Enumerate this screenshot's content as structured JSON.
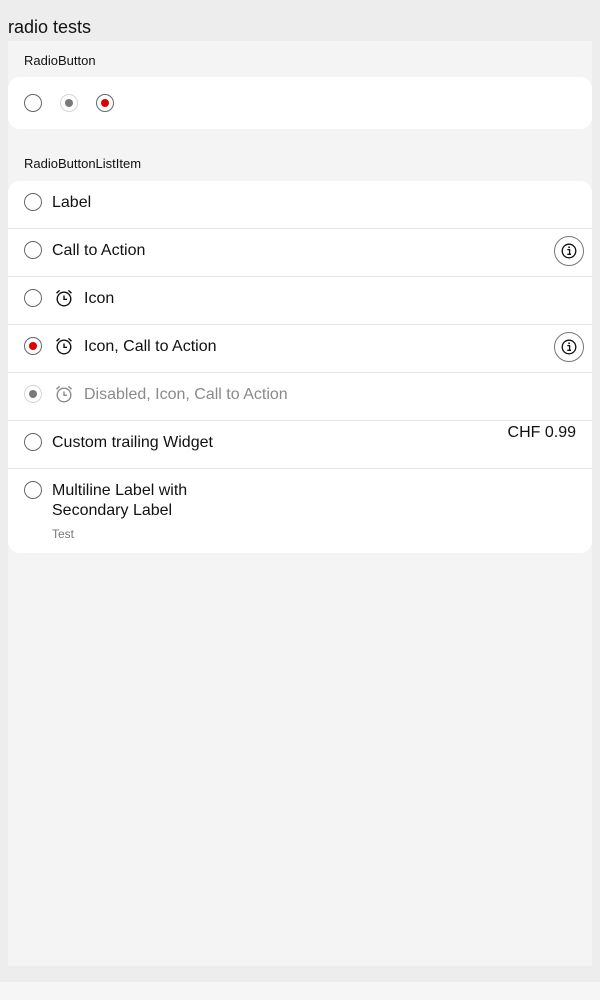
{
  "page": {
    "title": "radio tests"
  },
  "radio_button_section": {
    "label": "RadioButton",
    "radios": [
      {
        "state": "unchecked"
      },
      {
        "state": "checked-disabled"
      },
      {
        "state": "checked"
      }
    ]
  },
  "radio_list_section": {
    "label": "RadioButtonListItem",
    "items": [
      {
        "label": "Label",
        "checked": false
      },
      {
        "label": "Call to Action",
        "checked": false,
        "trailing_icon": "info-icon"
      },
      {
        "label": "Icon",
        "checked": false,
        "leading_icon": "alarm-icon"
      },
      {
        "label": "Icon, Call to Action",
        "checked": true,
        "leading_icon": "alarm-icon",
        "trailing_icon": "info-icon"
      },
      {
        "label": "Disabled, Icon, Call to Action",
        "checked": true,
        "disabled": true,
        "leading_icon": "alarm-icon"
      },
      {
        "label": "Custom trailing Widget",
        "checked": false,
        "trailing_text": "CHF 0.99"
      },
      {
        "label_line1": "Multiline Label with",
        "label_line2": "Secondary Label",
        "secondary": "Test",
        "checked": false
      }
    ]
  },
  "colors": {
    "accent": "#e00000",
    "background": "#ededed",
    "content_background": "#f4f4f4",
    "card": "#ffffff",
    "disabled": "#8a8a8a"
  }
}
